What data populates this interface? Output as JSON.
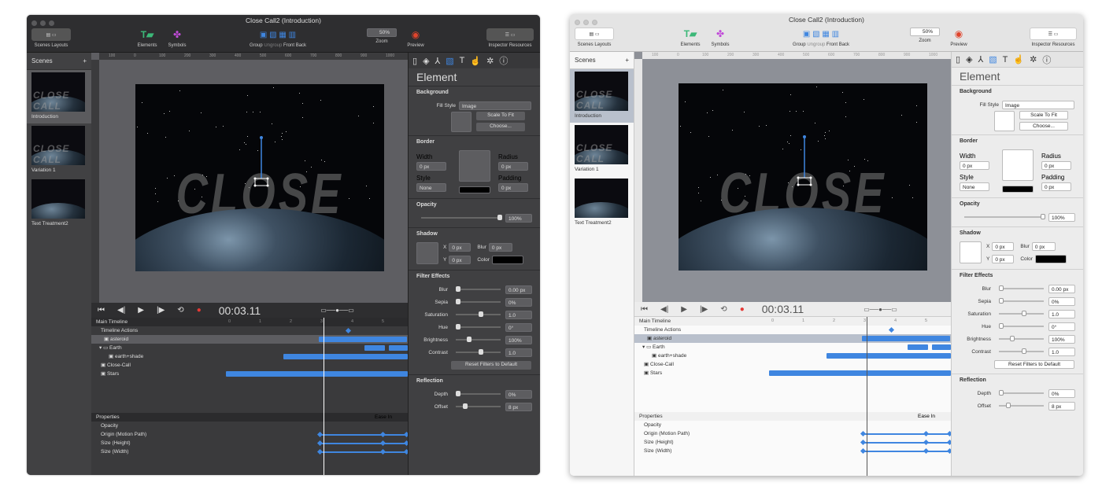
{
  "window": {
    "title": "Close Call2 (Introduction)"
  },
  "toolbar": {
    "scenes": "Scenes",
    "layouts": "Layouts",
    "elements": "Elements",
    "symbols": "Symbols",
    "group": "Group",
    "ungroup": "Ungroup",
    "front": "Front",
    "back": "Back",
    "zoom_value": "50%",
    "zoom": "Zoom",
    "preview": "Preview",
    "inspector": "Inspector",
    "resources": "Resources"
  },
  "scenes": {
    "header": "Scenes",
    "add": "+",
    "items": [
      {
        "label": "Introduction"
      },
      {
        "label": "Variation 1"
      },
      {
        "label": "Text Treatment2"
      }
    ]
  },
  "canvas": {
    "ruler": [
      "100",
      "0",
      "100",
      "200",
      "300",
      "400",
      "500",
      "600",
      "700",
      "800",
      "900",
      "1000"
    ],
    "title_text": "CLOSE CALL"
  },
  "timeline": {
    "time": "00:03.11",
    "main": "Main Timeline",
    "ticks": [
      "0",
      "1",
      "2",
      "3",
      "4",
      "5",
      "6"
    ],
    "rows": [
      "Timeline Actions",
      "asteroid",
      "Earth",
      "earth+shade",
      "Close-Call",
      "Stars"
    ],
    "properties": "Properties",
    "ease": "Ease In",
    "props": [
      "Opacity",
      "Origin (Motion Path)",
      "Size (Height)",
      "Size (Width)"
    ]
  },
  "inspector": {
    "title": "Element",
    "background": "Background",
    "fill_style_label": "Fill Style",
    "fill_style": "Image",
    "scale": "Scale To Fit",
    "choose": "Choose...",
    "border": "Border",
    "width_label": "Width",
    "width": "0 px",
    "radius_label": "Radius",
    "radius": "0 px",
    "style_label": "Style",
    "style": "None",
    "padding_label": "Padding",
    "padding": "0 px",
    "opacity": "Opacity",
    "opacity_value": "100%",
    "shadow": "Shadow",
    "x_label": "X",
    "x": "0 px",
    "y_label": "Y",
    "y": "0 px",
    "blur_label": "Blur",
    "blur": "0 px",
    "color_label": "Color",
    "filter": "Filter Effects",
    "filters": [
      {
        "label": "Blur",
        "value": "0.00 px",
        "pos": 0
      },
      {
        "label": "Sepia",
        "value": "0%",
        "pos": 0
      },
      {
        "label": "Saturation",
        "value": "1.0",
        "pos": 0.5
      },
      {
        "label": "Hue",
        "value": "0°",
        "pos": 0
      },
      {
        "label": "Brightness",
        "value": "100%",
        "pos": 0.25
      },
      {
        "label": "Contrast",
        "value": "1.0",
        "pos": 0.5
      }
    ],
    "reset": "Reset Filters to Default",
    "reflection": "Reflection",
    "depth_label": "Depth",
    "depth": "0%",
    "offset_label": "Offset",
    "offset": "8 px"
  }
}
